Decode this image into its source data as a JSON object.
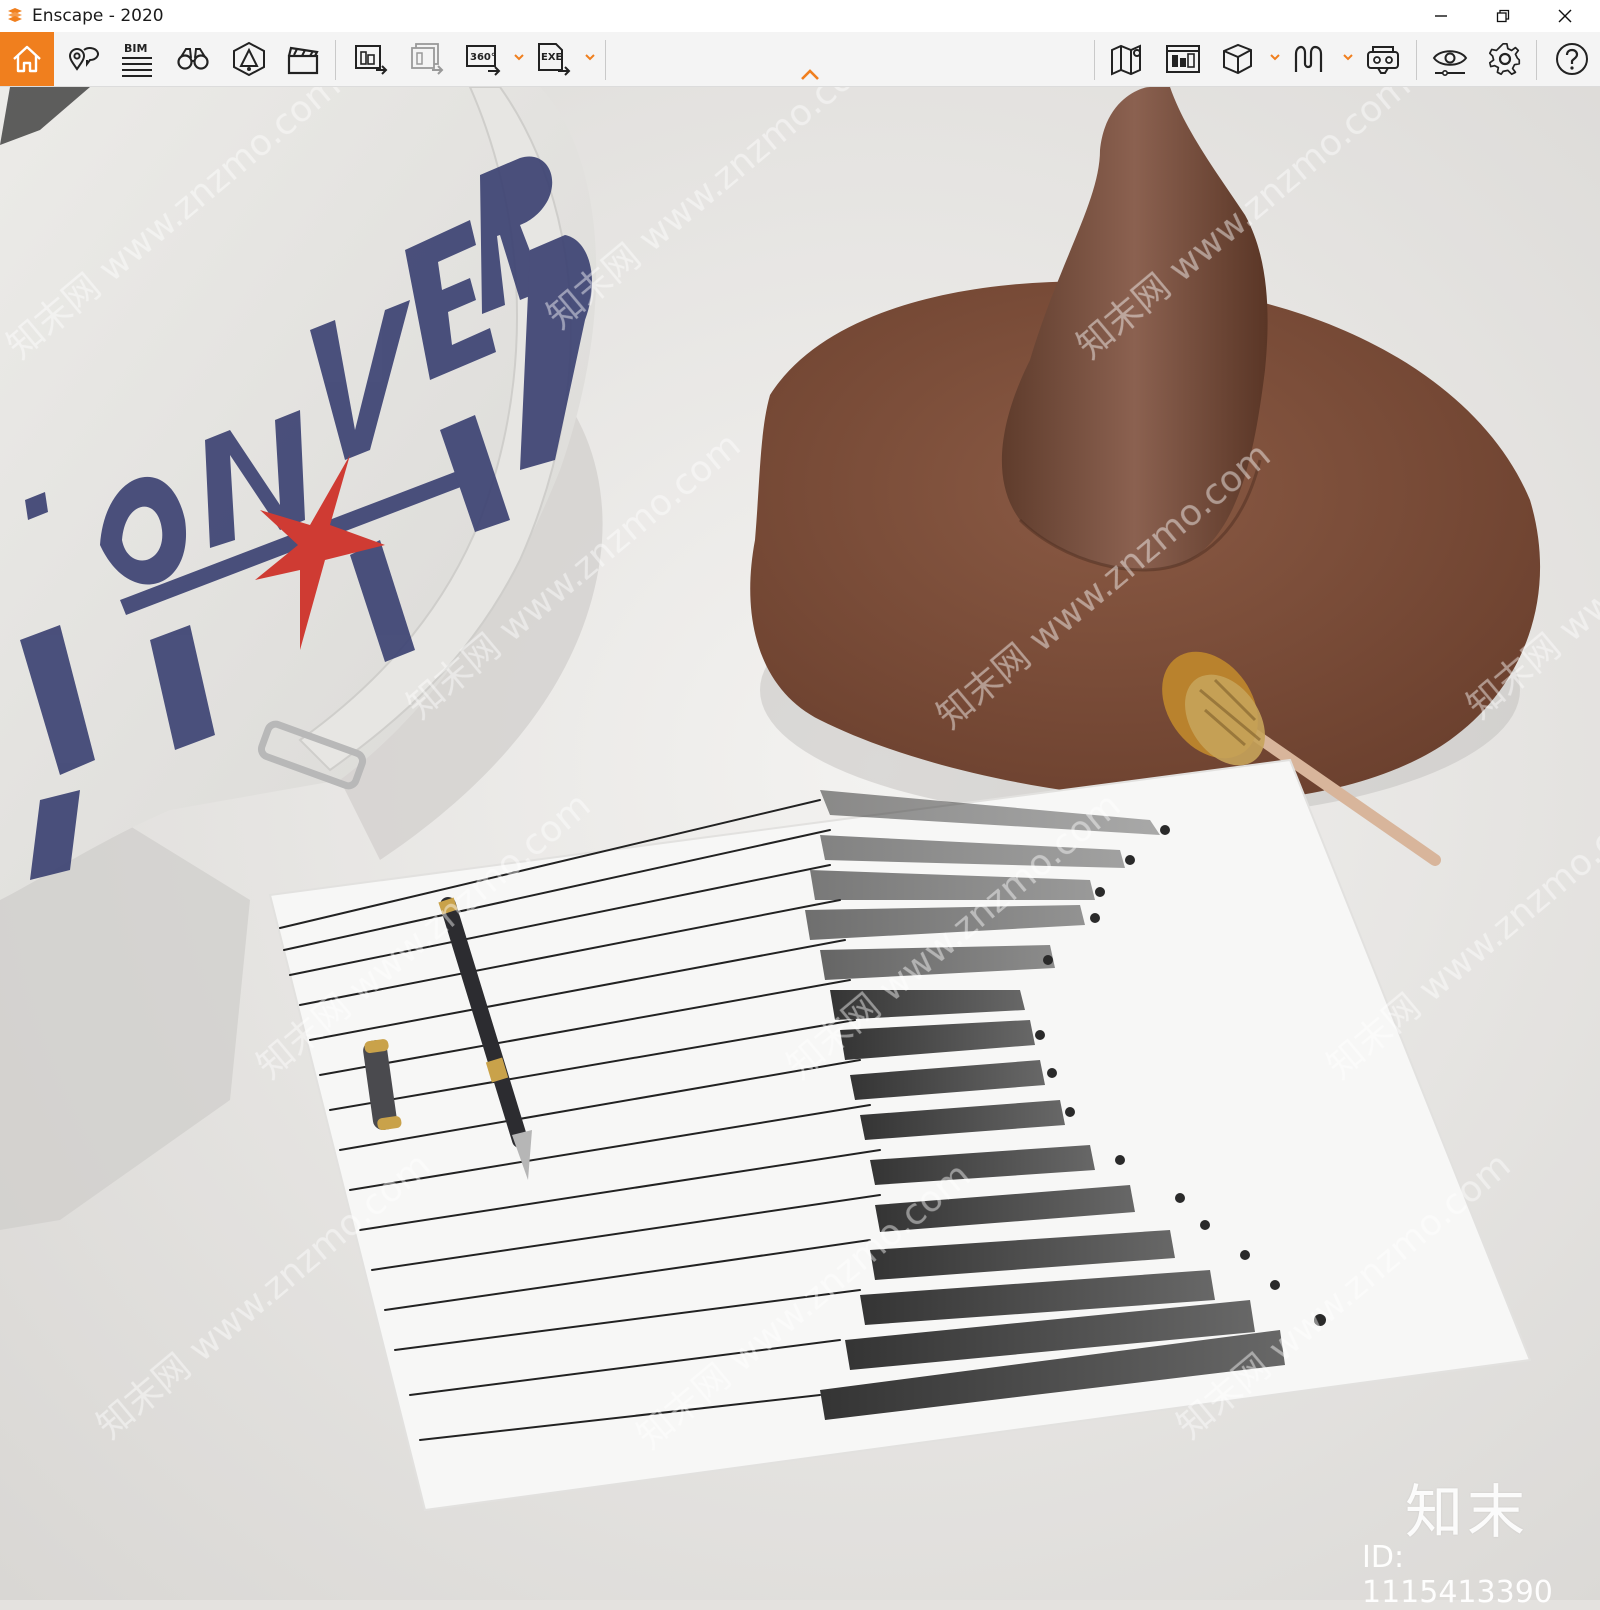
{
  "window": {
    "title": "Enscape - 2020",
    "controls": [
      "minimize-icon",
      "restore-icon",
      "close-icon"
    ]
  },
  "toolbar": {
    "accent_color": "#f07f1e",
    "bim_label": "BIM",
    "pano_label": "360°",
    "exe_label": "EXE",
    "left_tools": [
      "home-icon",
      "views-icon",
      "bim-icon",
      "binoculars-icon",
      "sun-icon",
      "clapperboard-icon",
      "screenshot-export-icon",
      "batch-export-icon",
      "panorama-export-icon",
      "exe-export-icon"
    ],
    "right_tools": [
      "map-icon",
      "asset-library-icon",
      "cube-icon",
      "material-icon",
      "vr-headset-icon",
      "eye-visual-settings-icon",
      "gear-icon",
      "help-icon"
    ]
  },
  "scene": {
    "bag_print": "CONVERSE ALL STAR",
    "watermark_repeat": "知末网 www.znzmo.com",
    "watermark_brand": "知末",
    "watermark_id": "ID: 1115413390"
  }
}
